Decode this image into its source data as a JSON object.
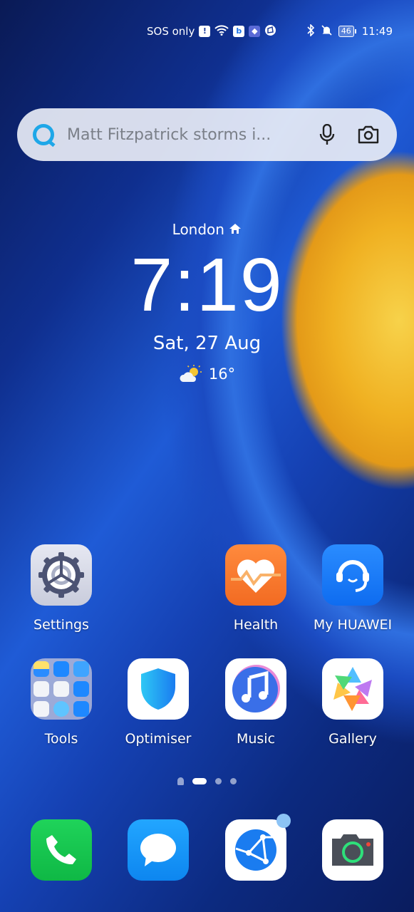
{
  "status_bar": {
    "carrier": "SOS only",
    "left_icons": [
      "alert-icon",
      "wifi-icon",
      "bing-icon",
      "app-notification-icon",
      "browser-notification-icon"
    ],
    "right_icons": [
      "bluetooth-icon",
      "mute-icon"
    ],
    "battery": "46",
    "time": "11:49"
  },
  "search": {
    "placeholder": "Matt Fitzpatrick storms i...",
    "accent": "#1ea7e8"
  },
  "clock_widget": {
    "city": "London",
    "time": "7:19",
    "date": "Sat, 27 Aug",
    "temperature": "16°",
    "weather_icon": "partly-cloudy-icon"
  },
  "apps": {
    "settings": "Settings",
    "health": "Health",
    "myhuawei": "My HUAWEI",
    "tools": "Tools",
    "optimiser": "Optimiser",
    "music": "Music",
    "gallery": "Gallery"
  },
  "dock": [
    "Phone",
    "Messaging",
    "Browser",
    "Camera"
  ],
  "page_indicator": {
    "pages": 3,
    "active": 1
  }
}
